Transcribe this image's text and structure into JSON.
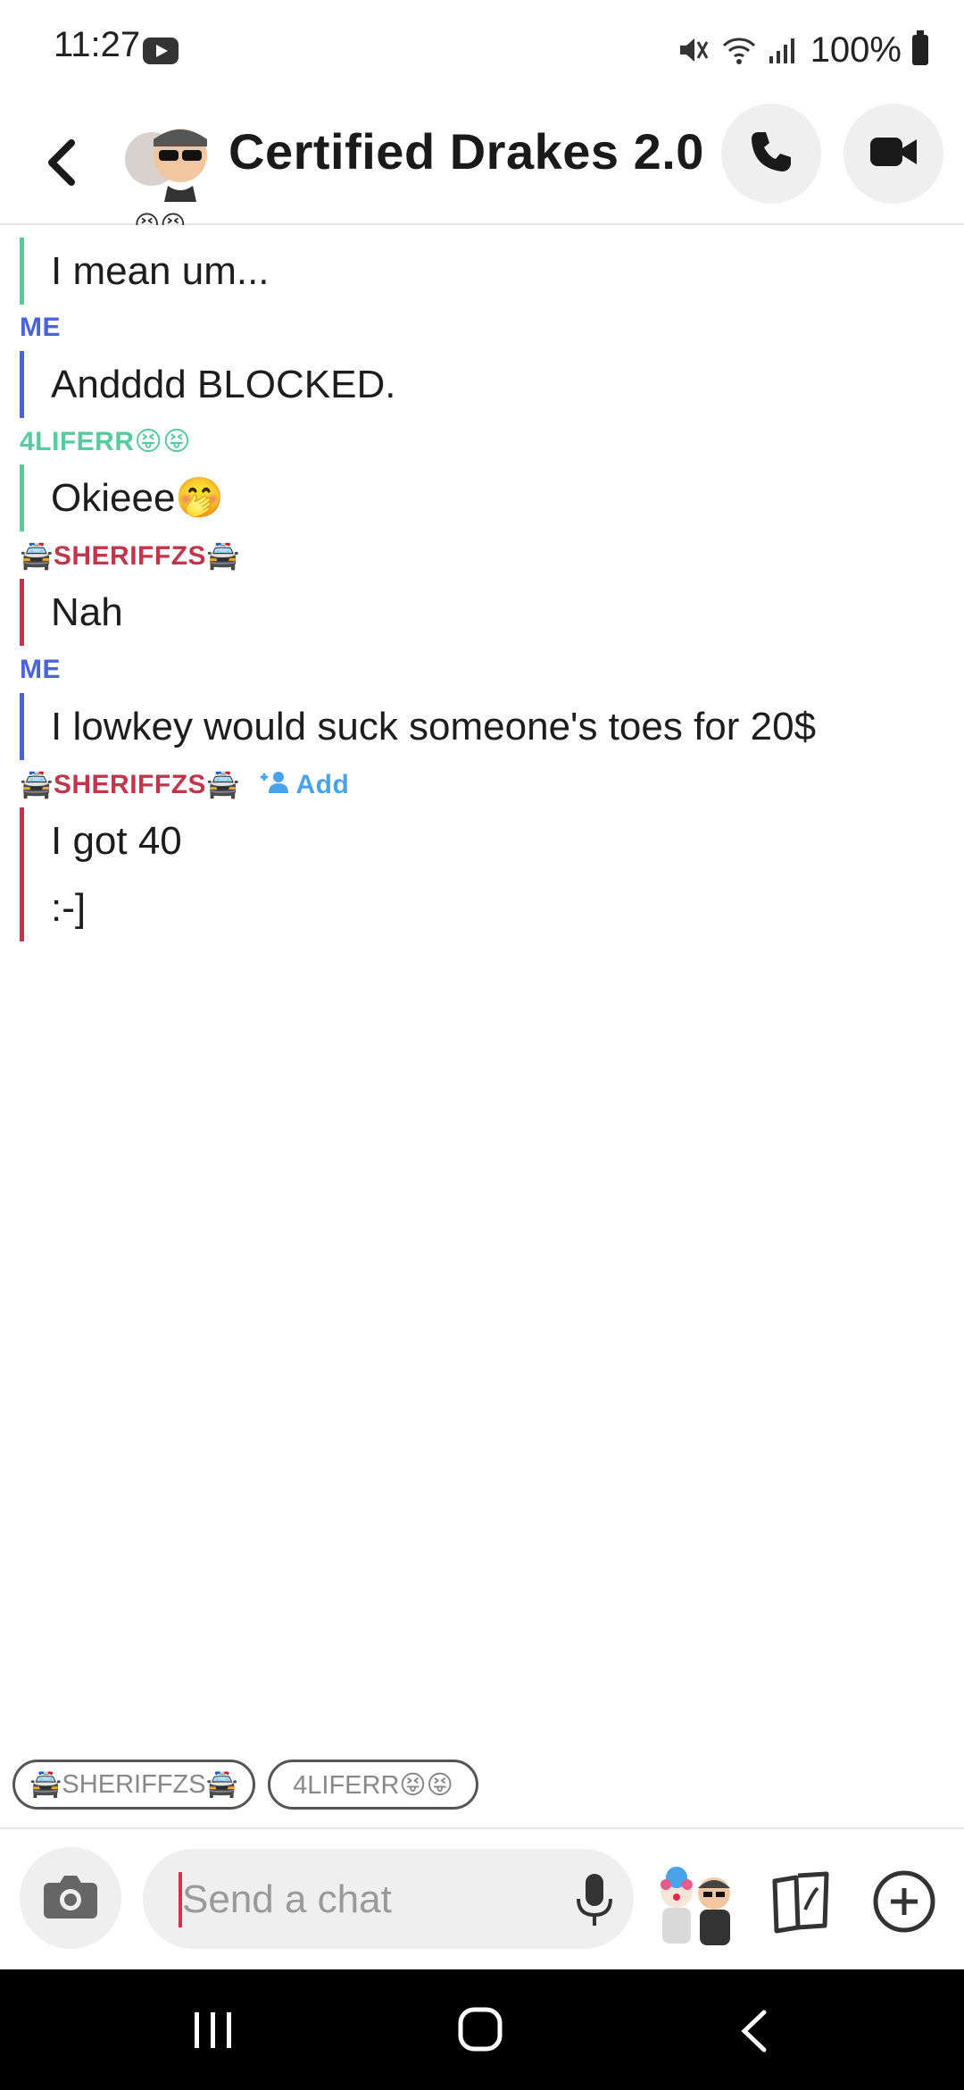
{
  "status_bar": {
    "time": "11:27",
    "battery": "100%"
  },
  "header": {
    "title": "Certified Drakes 2.0",
    "avatar_icon": "group-bitmoji-avatar",
    "call_icon": "phone-icon",
    "video_icon": "video-camera-icon"
  },
  "messages": {
    "partial_top_emoji": "😝😝",
    "groups": [
      {
        "sender": "",
        "color": "#5bc9a0",
        "lines": [
          "I mean um..."
        ]
      },
      {
        "sender": "ME",
        "color": "#4a63d8",
        "lines": [
          "Andddd BLOCKED."
        ]
      },
      {
        "sender": "4LIFERR😝😝",
        "color": "#5bc9a0",
        "lines": [
          "Okieee🤭"
        ]
      },
      {
        "sender": "🚔SHERIFFZS🚔",
        "color": "#c0364a",
        "lines": [
          "Nah"
        ]
      },
      {
        "sender": "ME",
        "color": "#4a63d8",
        "lines": [
          "I lowkey would suck someone's toes for 20$"
        ]
      },
      {
        "sender": "🚔SHERIFFZS🚔",
        "color": "#c0364a",
        "add_label": "Add",
        "lines": [
          "I got 40",
          ":-]"
        ]
      }
    ]
  },
  "quick_replies": [
    "🚔SHERIFFZS🚔",
    "4LIFERR😝😝"
  ],
  "input": {
    "placeholder": "Send a chat",
    "value": ""
  },
  "colors": {
    "me": "#4a63d8",
    "liferr": "#5bc9a0",
    "sheriff": "#c0364a",
    "add_link": "#4aa3e8",
    "cursor": "#e8274b"
  }
}
